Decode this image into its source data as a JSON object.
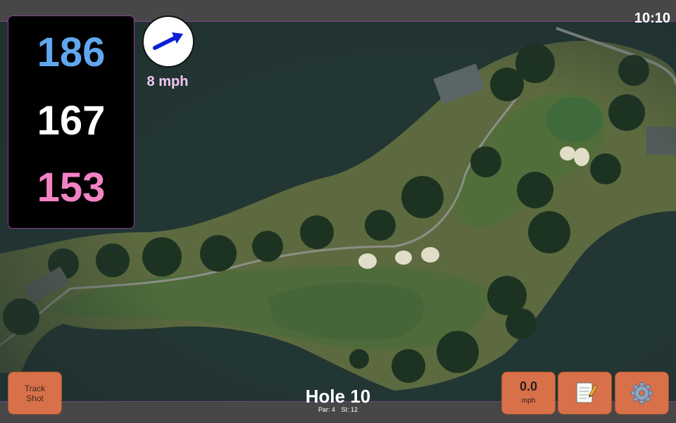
{
  "clock": "10:10",
  "distances": {
    "back": "186",
    "middle": "167",
    "front": "153"
  },
  "wind": {
    "speed_label": "8 mph",
    "direction_icon": "wind-arrow-icon",
    "arrow_color": "#0b1fd6"
  },
  "hole": {
    "title": "Hole 10",
    "par": "Par: 4",
    "stroke_index": "SI: 12"
  },
  "buttons": {
    "track_shot": {
      "line1": "Track",
      "line2": "Shot"
    },
    "speed": {
      "value": "0.0",
      "unit": "mph"
    },
    "notes_icon": "notepad-icon",
    "settings_icon": "gear-icon"
  },
  "colors": {
    "accent_border": "#8b3f9c",
    "button_bg": "#d8714a",
    "back_distance": "#5fa8f0",
    "front_distance": "#f282c3"
  }
}
